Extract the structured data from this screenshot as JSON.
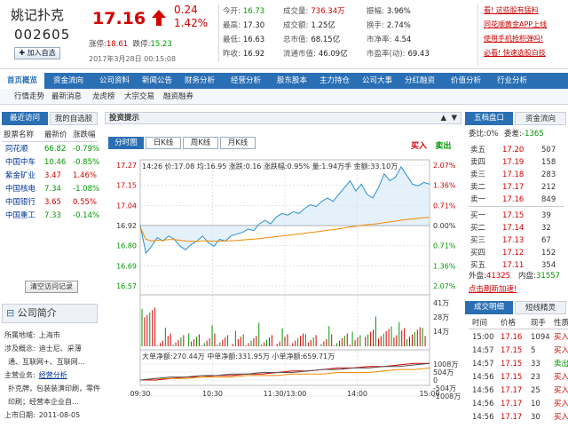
{
  "header": {
    "name": "姚记扑克",
    "code": "002605",
    "add_button": "加入自选",
    "price": "17.16",
    "change": "0.24",
    "change_pct": "1.42%",
    "limit_up_label": "涨停:",
    "limit_up": "18.61",
    "limit_down_label": "跌停:",
    "limit_down": "15.23",
    "datetime": "2017年3月28日 00:15:08",
    "quotes": [
      {
        "label": "今开:",
        "value": "16.73",
        "cls": "grn"
      },
      {
        "label": "最高:",
        "value": "17.30",
        "cls": "v"
      },
      {
        "label": "最低:",
        "value": "16.63",
        "cls": "v"
      },
      {
        "label": "昨收:",
        "value": "16.92",
        "cls": "v"
      },
      {
        "label": "成交量:",
        "value": "736.34万",
        "cls": "red"
      },
      {
        "label": "成交额:",
        "value": "1.25亿",
        "cls": "v"
      },
      {
        "label": "总市值:",
        "value": "68.15亿",
        "cls": "v"
      },
      {
        "label": "流通市值:",
        "value": "46.09亿",
        "cls": "v"
      },
      {
        "label": "振幅:",
        "value": "3.96%",
        "cls": "v"
      },
      {
        "label": "换手:",
        "value": "2.74%",
        "cls": "v"
      },
      {
        "label": "市净率:",
        "value": "4.54",
        "cls": "v"
      },
      {
        "label": "市盈率(动):",
        "value": "69.43",
        "cls": "v"
      }
    ],
    "links": [
      "看! 这些股有猛料",
      "同花顺黄金APP上线",
      "使用手机抢积弹吗!",
      "必看! 快速选股白技"
    ]
  },
  "nav1": [
    "首页概览",
    "资金流向",
    "公司资料",
    "新闻公告",
    "财务分析",
    "经营分析",
    "股东股本",
    "主力持仓",
    "公司大事",
    "分红融资",
    "价值分析",
    "行业分析"
  ],
  "nav2": [
    "行情走势",
    "最新消息",
    "龙虎榜",
    "大宗交易",
    "融资融券"
  ],
  "left": {
    "tab_recent": "最近访问",
    "tab_mine": "我的自选股",
    "headers": [
      "股票名称",
      "最新价",
      "涨跌幅"
    ],
    "rows": [
      {
        "name": "同花顺",
        "price": "66.82",
        "pct": "-0.79%",
        "c": "gr"
      },
      {
        "name": "中国中车",
        "price": "10.46",
        "pct": "-0.85%",
        "c": "gr"
      },
      {
        "name": "紫金矿业",
        "price": "3.47",
        "pct": "1.46%",
        "c": "rd"
      },
      {
        "name": "中国核电",
        "price": "7.34",
        "pct": "-1.08%",
        "c": "gr"
      },
      {
        "name": "中国银行",
        "price": "3.65",
        "pct": "0.55%",
        "c": "rd"
      },
      {
        "name": "中国重工",
        "price": "7.33",
        "pct": "-0.14%",
        "c": "gr"
      }
    ],
    "clear_button": "清空访问记录",
    "company_title": "公司简介",
    "company_lines": [
      {
        "label": "所属地域:",
        "value": "上海市"
      },
      {
        "label": "涉及概念:",
        "value": "迪士尼、采薄"
      },
      {
        "label": "",
        "value": "通、互联网+、互联网…"
      },
      {
        "label": "主营业务:",
        "value": "经营分析"
      },
      {
        "label": "",
        "value": "扑克牌，包装装潢印刷，零件"
      },
      {
        "label": "",
        "value": "印刷；经营本企业自…"
      },
      {
        "label": "上市日期:",
        "value": "2011-08-05"
      }
    ]
  },
  "center": {
    "title": "投资提示",
    "tabs": [
      "分时图",
      "日K线",
      "周K线",
      "月K线"
    ],
    "buy": "买入",
    "sell": "卖出",
    "info": {
      "time": "14:26",
      "avg_label": "价:",
      "price": "17.08",
      "avg": "16.95",
      "chg": "0.16",
      "pct": "0.95%",
      "vol": "1.94万手",
      "amt": "33.10万"
    },
    "info_labels": {
      "avg": "均:",
      "chg": "涨跌:",
      "pct": "涨跌幅:",
      "vol": "量:",
      "amt": "金额:"
    },
    "y_left": [
      "17.27",
      "17.15",
      "17.04",
      "16.92",
      "16.80",
      "16.69",
      "16.57"
    ],
    "y_right": [
      "2.07%",
      "1.36%",
      "0.71%",
      "0.00%",
      "0.71%",
      "1.36%",
      "2.07%"
    ],
    "vol_labels": [
      "41万",
      "28万",
      "14万"
    ],
    "flow_title": {
      "a": "大单净额:270.44万",
      "b": "中单净额:331.95万",
      "c": "小单净额:659.71万"
    },
    "flow_labels": [
      "1008万",
      "504万",
      "0",
      "-504万",
      "-1008万"
    ],
    "x_labels": [
      "09:30",
      "10:30",
      "11:30/13:00",
      "14:00",
      "15:00"
    ]
  },
  "right": {
    "tab_orderbook": "五档盘口",
    "tab_flow": "资金流向",
    "wb_label": "委比:",
    "wb": "0%",
    "wc_label": "委差:",
    "wc": "-1365",
    "sells": [
      {
        "l": "卖五",
        "p": "17.20",
        "v": "507"
      },
      {
        "l": "卖四",
        "p": "17.19",
        "v": "158"
      },
      {
        "l": "卖三",
        "p": "17.18",
        "v": "283"
      },
      {
        "l": "卖二",
        "p": "17.17",
        "v": "212"
      },
      {
        "l": "卖一",
        "p": "17.16",
        "v": "849"
      }
    ],
    "buys": [
      {
        "l": "买一",
        "p": "17.15",
        "v": "39"
      },
      {
        "l": "买二",
        "p": "17.14",
        "v": "32"
      },
      {
        "l": "买三",
        "p": "17.13",
        "v": "67"
      },
      {
        "l": "买四",
        "p": "17.12",
        "v": "152"
      },
      {
        "l": "买五",
        "p": "17.11",
        "v": "354"
      }
    ],
    "outer_label": "外盘:",
    "outer": "41325",
    "inner_label": "内盘:",
    "inner": "31557",
    "refresh": "点击刷新加速!",
    "tab_detail": "成交明细",
    "tab_short": "短线精灵",
    "detail_headers": [
      "时间",
      "价格",
      "现手",
      "性质"
    ],
    "details": [
      {
        "t": "15:00",
        "p": "17.16",
        "v": "1094",
        "k": "买入",
        "c": "rd"
      },
      {
        "t": "14:57",
        "p": "17.15",
        "v": "5",
        "k": "买入",
        "c": "rd"
      },
      {
        "t": "14:57",
        "p": "17.15",
        "v": "33",
        "k": "卖出",
        "c": "gr"
      },
      {
        "t": "14:56",
        "p": "17.15",
        "v": "23",
        "k": "买入",
        "c": "rd"
      },
      {
        "t": "14:56",
        "p": "17.17",
        "v": "25",
        "k": "买入",
        "c": "rd"
      },
      {
        "t": "14:56",
        "p": "17.17",
        "v": "10",
        "k": "买入",
        "c": "rd"
      },
      {
        "t": "14:56",
        "p": "17.17",
        "v": "30",
        "k": "买入",
        "c": "rd"
      }
    ]
  },
  "colors": {
    "accent": "#2a6fb4",
    "up": "#d40000",
    "down": "#009900",
    "price_line": "#2a8fd6",
    "avg_line": "#f08a00"
  }
}
